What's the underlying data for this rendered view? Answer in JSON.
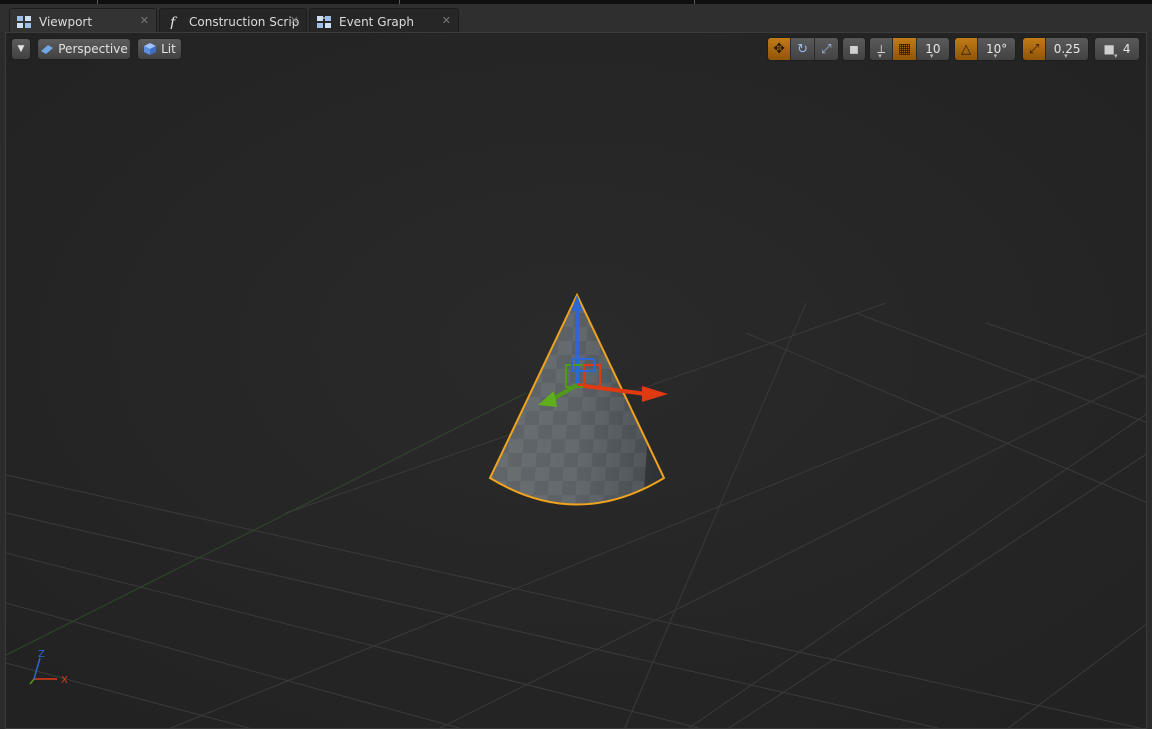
{
  "tabs": [
    {
      "label": "Viewport",
      "icon": "viewport-grid-icon",
      "active": true
    },
    {
      "label": "Construction Scrip",
      "icon": "function-f-icon",
      "active": false
    },
    {
      "label": "Event Graph",
      "icon": "event-graph-icon",
      "active": false
    }
  ],
  "toolbar": {
    "view_mode": "Perspective",
    "lighting_mode": "Lit",
    "grid_snap_value": "10",
    "rotation_snap_value": "10°",
    "scale_snap_value": "0.25",
    "camera_speed_value": "4"
  },
  "axis_gizmo": {
    "x_label": "X",
    "z_label": "Z"
  },
  "colors": {
    "accent_orange": "#d9901b",
    "selection_outline": "#f0a31c",
    "axis_x": "#e03a12",
    "axis_y": "#4f9a18",
    "axis_z": "#2d68d0",
    "background": "#252525"
  }
}
